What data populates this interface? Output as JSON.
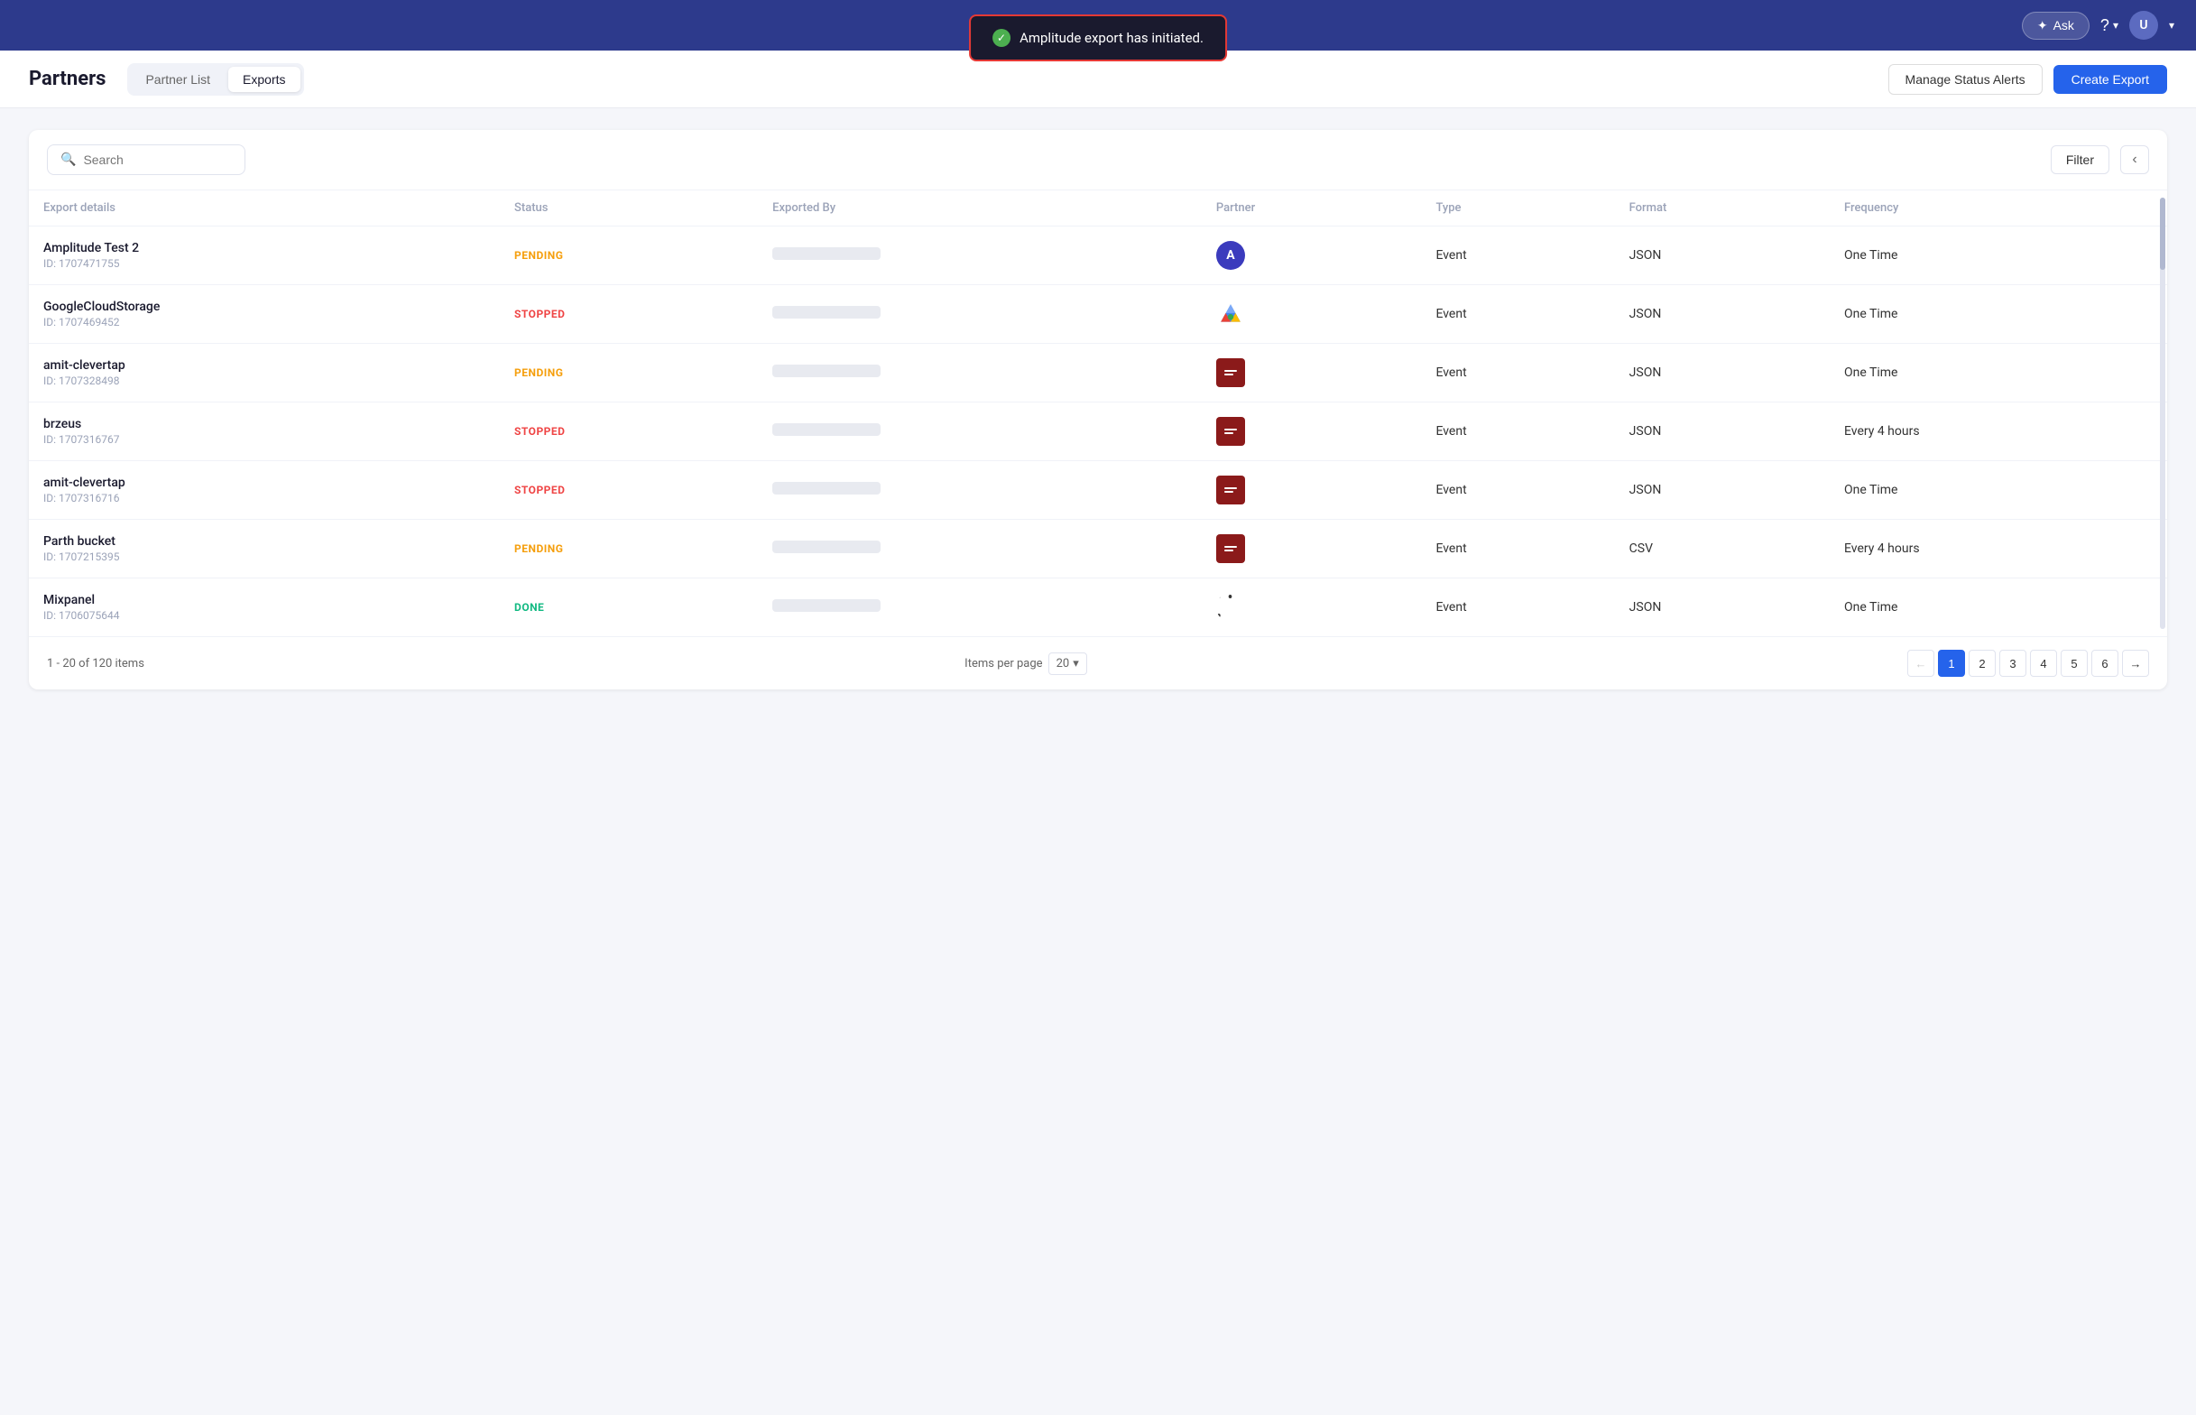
{
  "nav": {
    "ask_label": "Ask",
    "avatar_letter": "U"
  },
  "toast": {
    "message": "Amplitude export has initiated.",
    "icon": "✓"
  },
  "header": {
    "title": "Partners",
    "tabs": [
      {
        "id": "partner-list",
        "label": "Partner List",
        "active": false
      },
      {
        "id": "exports",
        "label": "Exports",
        "active": true
      }
    ],
    "manage_alerts_label": "Manage Status Alerts",
    "create_export_label": "Create Export"
  },
  "toolbar": {
    "search_placeholder": "Search",
    "filter_label": "Filter"
  },
  "table": {
    "columns": [
      {
        "id": "export-details",
        "label": "Export details"
      },
      {
        "id": "status",
        "label": "Status"
      },
      {
        "id": "exported-by",
        "label": "Exported By"
      },
      {
        "id": "partner",
        "label": "Partner"
      },
      {
        "id": "type",
        "label": "Type"
      },
      {
        "id": "format",
        "label": "Format"
      },
      {
        "id": "frequency",
        "label": "Frequency"
      }
    ],
    "rows": [
      {
        "name": "Amplitude Test 2",
        "id": "ID: 1707471755",
        "status": "PENDING",
        "status_class": "pending",
        "partner_type": "amplitude",
        "type": "Event",
        "format": "JSON",
        "frequency": "One Time"
      },
      {
        "name": "GoogleCloudStorage",
        "id": "ID: 1707469452",
        "status": "STOPPED",
        "status_class": "stopped",
        "partner_type": "gcs",
        "type": "Event",
        "format": "JSON",
        "frequency": "One Time"
      },
      {
        "name": "amit-clevertap",
        "id": "ID: 1707328498",
        "status": "PENDING",
        "status_class": "pending",
        "partner_type": "clevertap",
        "type": "Event",
        "format": "JSON",
        "frequency": "One Time"
      },
      {
        "name": "brzeus",
        "id": "ID: 1707316767",
        "status": "STOPPED",
        "status_class": "stopped",
        "partner_type": "clevertap",
        "type": "Event",
        "format": "JSON",
        "frequency": "Every 4 hours"
      },
      {
        "name": "amit-clevertap",
        "id": "ID: 1707316716",
        "status": "STOPPED",
        "status_class": "stopped",
        "partner_type": "clevertap",
        "type": "Event",
        "format": "JSON",
        "frequency": "One Time"
      },
      {
        "name": "Parth bucket",
        "id": "ID: 1707215395",
        "status": "PENDING",
        "status_class": "pending",
        "partner_type": "clevertap",
        "type": "Event",
        "format": "CSV",
        "frequency": "Every 4 hours"
      },
      {
        "name": "Mixpanel",
        "id": "ID: 1706075644",
        "status": "DONE",
        "status_class": "done",
        "partner_type": "mixpanel",
        "type": "Event",
        "format": "JSON",
        "frequency": "One Time"
      }
    ]
  },
  "pagination": {
    "info": "1 - 20 of 120 items",
    "per_page_label": "Items per page",
    "per_page_value": "20",
    "pages": [
      "1",
      "2",
      "3",
      "4",
      "5",
      "6"
    ],
    "current_page": "1"
  }
}
